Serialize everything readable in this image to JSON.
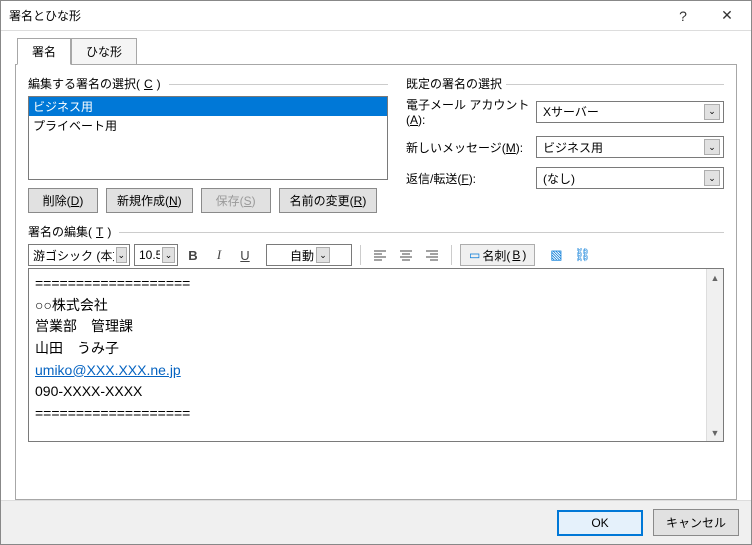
{
  "titlebar": {
    "title": "署名とひな形"
  },
  "tabs": {
    "signature": "署名",
    "template": "ひな形"
  },
  "left": {
    "group_label_pre": "編集する署名の選択(",
    "group_label_u": "C",
    "group_label_post": ")",
    "items": [
      "ビジネス用",
      "プライベート用"
    ],
    "buttons": {
      "delete_pre": "削除(",
      "delete_u": "D",
      "delete_post": ")",
      "new_pre": "新規作成(",
      "new_u": "N",
      "new_post": ")",
      "save_pre": "保存(",
      "save_u": "S",
      "save_post": ")",
      "rename_pre": "名前の変更(",
      "rename_u": "R",
      "rename_post": ")"
    }
  },
  "right": {
    "group_label": "既定の署名の選択",
    "row1_pre": "電子メール アカウント(",
    "row1_u": "A",
    "row1_post": "):",
    "row1_val": "Xサーバー",
    "row2_pre": "新しいメッセージ(",
    "row2_u": "M",
    "row2_post": "):",
    "row2_val": "ビジネス用",
    "row3_pre": "返信/転送(",
    "row3_u": "F",
    "row3_post": "):",
    "row3_val": "(なし)"
  },
  "edit": {
    "label_pre": "署名の編集(",
    "label_u": "T",
    "label_post": ")",
    "font_name": "游ゴシック (本文の",
    "font_size": "10.5",
    "auto_color": "自動",
    "b": "B",
    "i": "I",
    "u": "U",
    "bizcard_pre": "名刺(",
    "bizcard_u": "B",
    "bizcard_post": ")",
    "line_sep": "===================",
    "line_company": "○○株式会社",
    "line_dept": "営業部　管理課",
    "line_name": "山田　うみ子",
    "line_email": "umiko@XXX.XXX.ne.jp",
    "line_phone": "090-XXXX-XXXX"
  },
  "footer": {
    "ok": "OK",
    "cancel": "キャンセル"
  },
  "glyph": {
    "help": "?",
    "close": "✕",
    "caret": "⌄",
    "up": "▲",
    "down": "▼",
    "card": "▭",
    "img": "▧",
    "link": "⛓"
  }
}
